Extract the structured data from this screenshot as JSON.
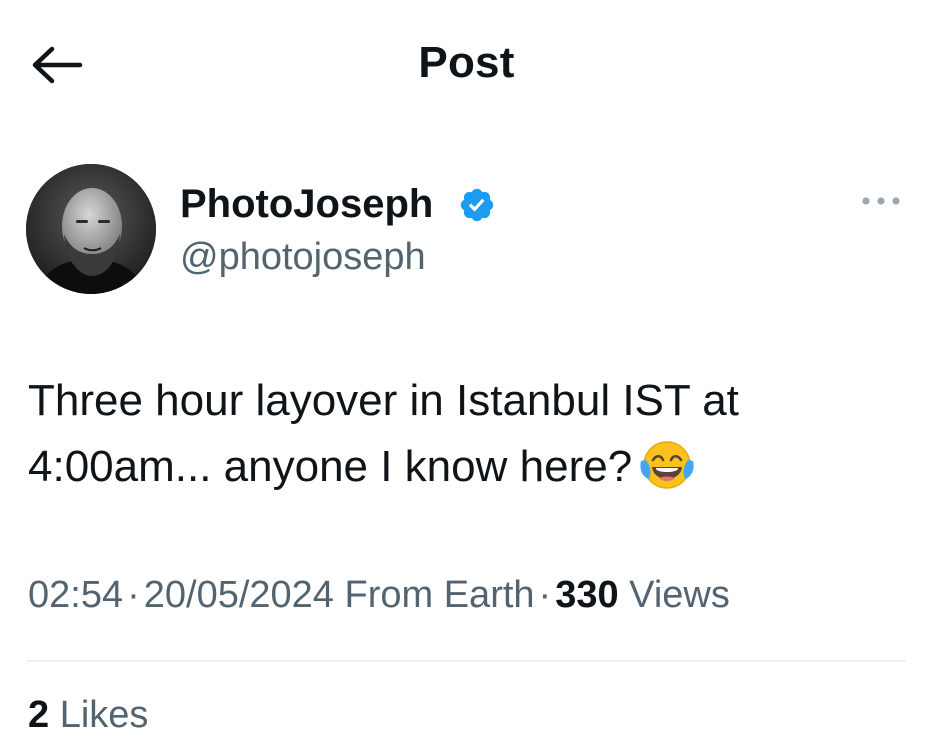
{
  "header": {
    "title": "Post",
    "back_icon": "arrow-left-icon"
  },
  "author": {
    "display_name": "PhotoJoseph",
    "handle": "@photojoseph",
    "verified": true,
    "verified_icon": "verified-badge-icon",
    "verified_color": "#1d9bf0",
    "more_icon": "more-horizontal-icon"
  },
  "post": {
    "text": "Three hour layover in Istanbul IST at 4:00am... anyone I know here?",
    "emoji_icon": "face-with-tears-of-joy-icon"
  },
  "meta": {
    "time": "02:54",
    "date": "20/05/2024",
    "source": "From Earth",
    "separator": "·",
    "views_count": "330",
    "views_label": "Views"
  },
  "stats": {
    "likes_count": "2",
    "likes_label": "Likes"
  },
  "colors": {
    "text_primary": "#0f1419",
    "text_secondary": "#536471",
    "divider": "#eff3f4"
  }
}
